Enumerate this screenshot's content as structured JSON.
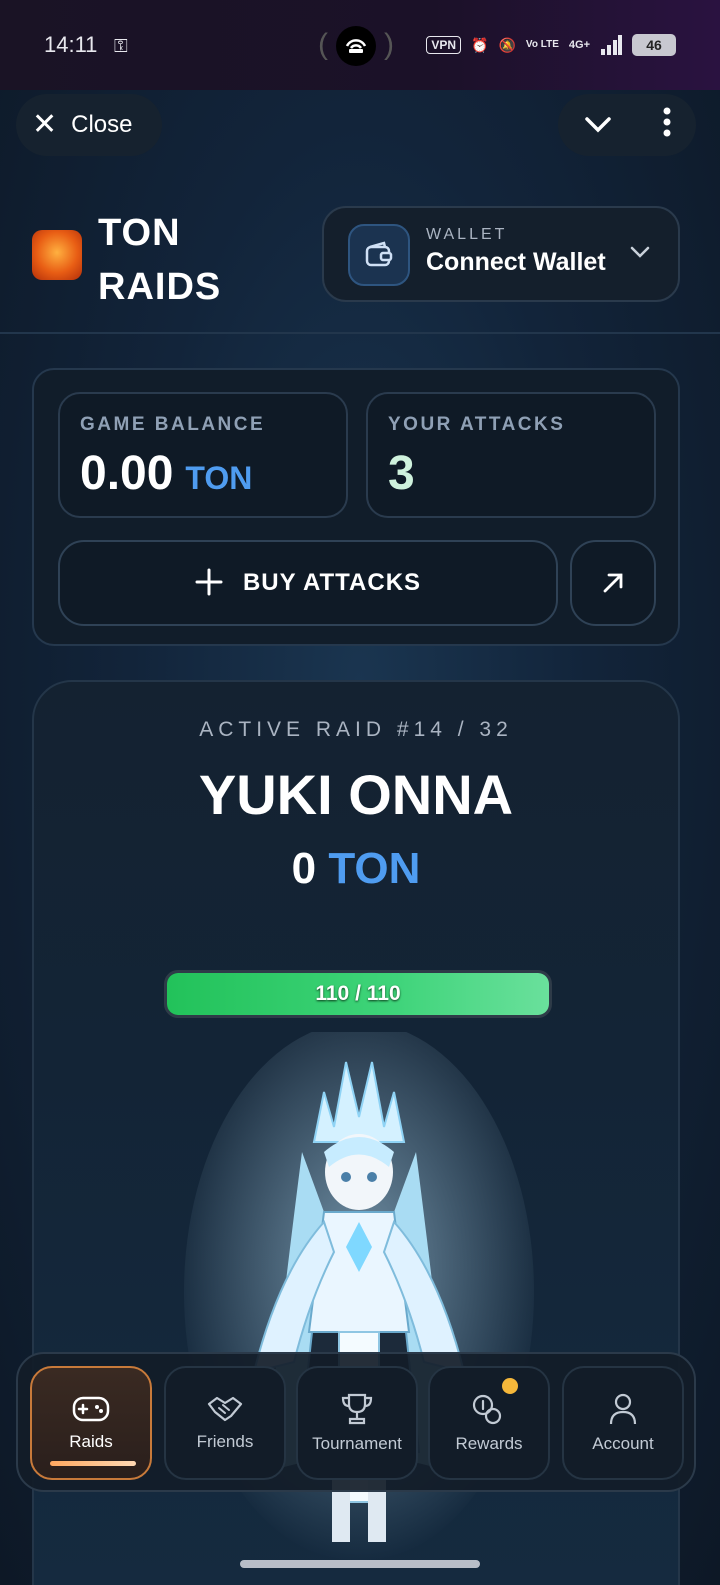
{
  "status_bar": {
    "time": "14:11",
    "vpn_label": "VPN",
    "network_label": "4G+",
    "lte_label": "Vo LTE",
    "battery": "46"
  },
  "topbar": {
    "close_label": "Close"
  },
  "header": {
    "brand_line1": "TON",
    "brand_line2": "RAIDS",
    "wallet_caption": "WALLET",
    "wallet_action": "Connect Wallet"
  },
  "stats": {
    "balance_label": "GAME BALANCE",
    "balance_value": "0.00",
    "balance_unit": "TON",
    "attacks_label": "YOUR ATTACKS",
    "attacks_value": "3",
    "buy_label": "BUY ATTACKS"
  },
  "raid": {
    "label": "ACTIVE RAID #14 / 32",
    "boss_name": "YUKI ONNA",
    "prize_value": "0",
    "prize_unit": "TON",
    "hp_text": "110 / 110",
    "hp_fraction": 1.0
  },
  "nav": {
    "items": [
      {
        "label": "Raids",
        "icon": "gamepad-icon",
        "active": true
      },
      {
        "label": "Friends",
        "icon": "handshake-icon",
        "active": false
      },
      {
        "label": "Tournament",
        "icon": "trophy-icon",
        "active": false
      },
      {
        "label": "Rewards",
        "icon": "coins-icon",
        "active": false,
        "badge": true
      },
      {
        "label": "Account",
        "icon": "user-icon",
        "active": false
      }
    ]
  },
  "colors": {
    "accent_blue": "#4f9cf0",
    "hp_green": "#22c25a",
    "active_tab_border": "#c87a3a",
    "badge": "#f5b73a"
  }
}
